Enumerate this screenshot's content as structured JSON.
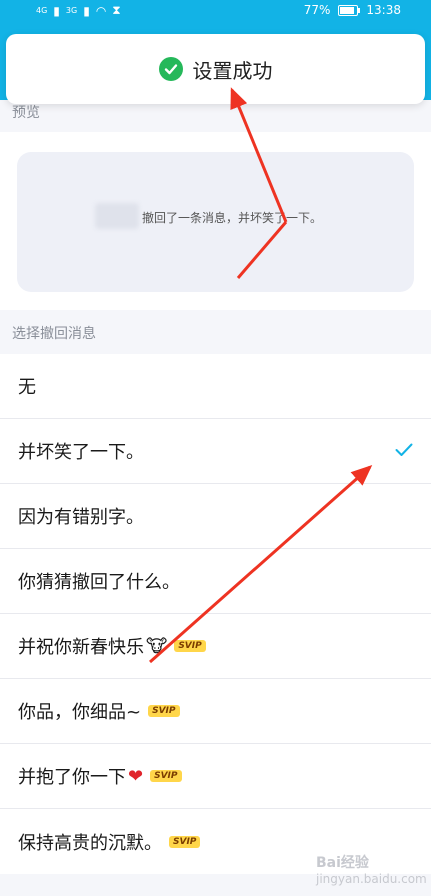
{
  "status_bar": {
    "signal_left": "4G",
    "signal_right": "3G",
    "battery_percent": "77%",
    "time": "13:38",
    "battery_level": 0.77
  },
  "toast": {
    "text": "设置成功",
    "icon": "check-circle-icon",
    "color": "#25b85a"
  },
  "preview": {
    "section_label": "预览",
    "message": "撤回了一条消息，并坏笑了一下。"
  },
  "recall": {
    "section_label": "选择撤回消息",
    "items": [
      {
        "label": "无",
        "svip": false,
        "selected": false
      },
      {
        "label": "并坏笑了一下。",
        "svip": false,
        "selected": true
      },
      {
        "label": "因为有错别字。",
        "svip": false,
        "selected": false
      },
      {
        "label": "你猜猜撤回了什么。",
        "svip": false,
        "selected": false
      },
      {
        "label": "并祝你新春快乐",
        "emoji": "🐮",
        "svip": true,
        "selected": false
      },
      {
        "label": "你品，你细品~",
        "svip": true,
        "selected": false
      },
      {
        "label": "并抱了你一下",
        "emoji": "❤",
        "svip": true,
        "selected": false
      },
      {
        "label": "保持高贵的沉默。",
        "svip": true,
        "selected": false
      }
    ],
    "svip_badge": "SVIP",
    "check_color": "#12b3e6"
  },
  "watermark": {
    "line1": "Bai经验",
    "line2": "jingyan.baidu.com"
  },
  "annotation_color": "#ee3322"
}
